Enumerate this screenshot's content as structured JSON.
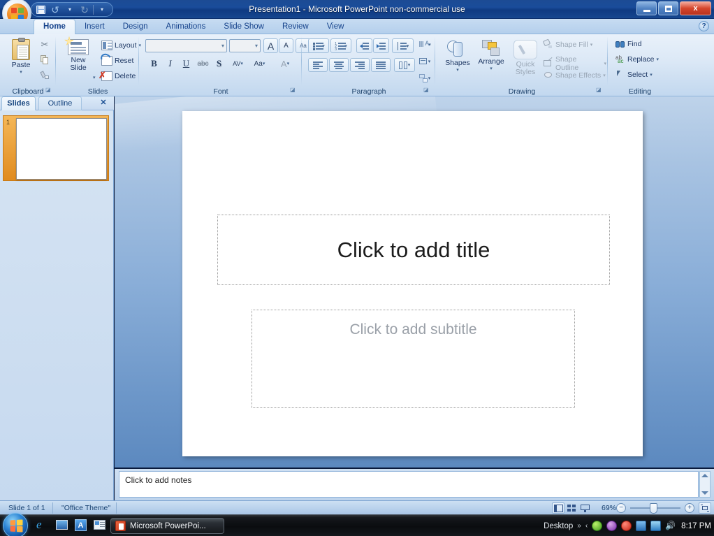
{
  "window": {
    "title": "Presentation1 - Microsoft PowerPoint non-commercial use",
    "minimize_label": "Minimize",
    "maximize_label": "Restore Down",
    "close_label": "x",
    "help_label": "?"
  },
  "quick_access": {
    "save": "save-icon",
    "undo": "↺",
    "redo": "↻",
    "customize": "▾"
  },
  "ribbon": {
    "tabs": [
      {
        "label": "Home",
        "active": true
      },
      {
        "label": "Insert",
        "active": false
      },
      {
        "label": "Design",
        "active": false
      },
      {
        "label": "Animations",
        "active": false
      },
      {
        "label": "Slide Show",
        "active": false
      },
      {
        "label": "Review",
        "active": false
      },
      {
        "label": "View",
        "active": false
      }
    ],
    "groups": {
      "clipboard": {
        "label": "Clipboard",
        "paste": "Paste",
        "cut": "✂",
        "copy": "copy-icon",
        "format_painter": "format-painter-icon",
        "dialog_launcher": "◪"
      },
      "slides": {
        "label": "Slides",
        "new_slide": "New\nSlide",
        "new_slide_line1": "New",
        "new_slide_line2": "Slide",
        "layout": "Layout",
        "reset": "Reset",
        "delete": "Delete"
      },
      "font": {
        "label": "Font",
        "font_name_value": "",
        "font_name_placeholder": "",
        "font_size_value": "",
        "font_size_placeholder": "",
        "grow_font": "A",
        "shrink_font": "A",
        "clear_formatting": "Aa",
        "bold": "B",
        "italic": "I",
        "underline": "U",
        "strikethrough": "abc",
        "shadow": "S",
        "character_spacing": "AV",
        "change_case": "Aa",
        "font_color": "A",
        "dialog_launcher": "◪"
      },
      "paragraph": {
        "label": "Paragraph",
        "bullets": "bullets-icon",
        "numbering": "numbering-icon",
        "decrease_indent": "decrease-indent-icon",
        "increase_indent": "increase-indent-icon",
        "line_spacing": "line-spacing-icon",
        "text_direction": "text-direction-icon",
        "align_text": "align-text-icon",
        "convert_smartart": "smartart-icon",
        "align_left": "align-left-icon",
        "center": "center-icon",
        "align_right": "align-right-icon",
        "justify": "justify-icon",
        "columns": "columns-icon",
        "dialog_launcher": "◪"
      },
      "drawing": {
        "label": "Drawing",
        "shapes": "Shapes",
        "arrange": "Arrange",
        "quick_styles_line1": "Quick",
        "quick_styles_line2": "Styles",
        "shape_fill": "Shape Fill",
        "shape_outline": "Shape Outline",
        "shape_effects": "Shape Effects",
        "dialog_launcher": "◪"
      },
      "editing": {
        "label": "Editing",
        "find": "Find",
        "replace": "Replace",
        "select": "Select"
      }
    }
  },
  "left_pane": {
    "tab_slides": "Slides",
    "tab_outline": "Outline",
    "close": "✕",
    "slides": [
      {
        "number": "1",
        "selected": true
      }
    ]
  },
  "slide": {
    "title_placeholder": "Click to add title",
    "subtitle_placeholder": "Click to add subtitle"
  },
  "notes": {
    "placeholder": "Click to add notes"
  },
  "status_bar": {
    "slide_indicator": "Slide 1 of 1",
    "theme": "\"Office Theme\"",
    "zoom_percent": "69%",
    "view_normal": "normal-view-icon",
    "view_sorter": "slide-sorter-icon",
    "view_show": "slide-show-icon",
    "zoom_out": "−",
    "zoom_in": "+",
    "fit_window": "fit-slide-to-window-icon"
  },
  "taskbar": {
    "start": "start-orb",
    "quick_launch": [
      "internet-explorer-icon",
      "show-desktop-icon",
      "blue-a-icon",
      "media-icon"
    ],
    "task_button": "Microsoft PowerPoi...",
    "tray_label": "Desktop",
    "tray_overflow": "»",
    "tray_chevron": "‹",
    "clock": "8:17 PM"
  }
}
